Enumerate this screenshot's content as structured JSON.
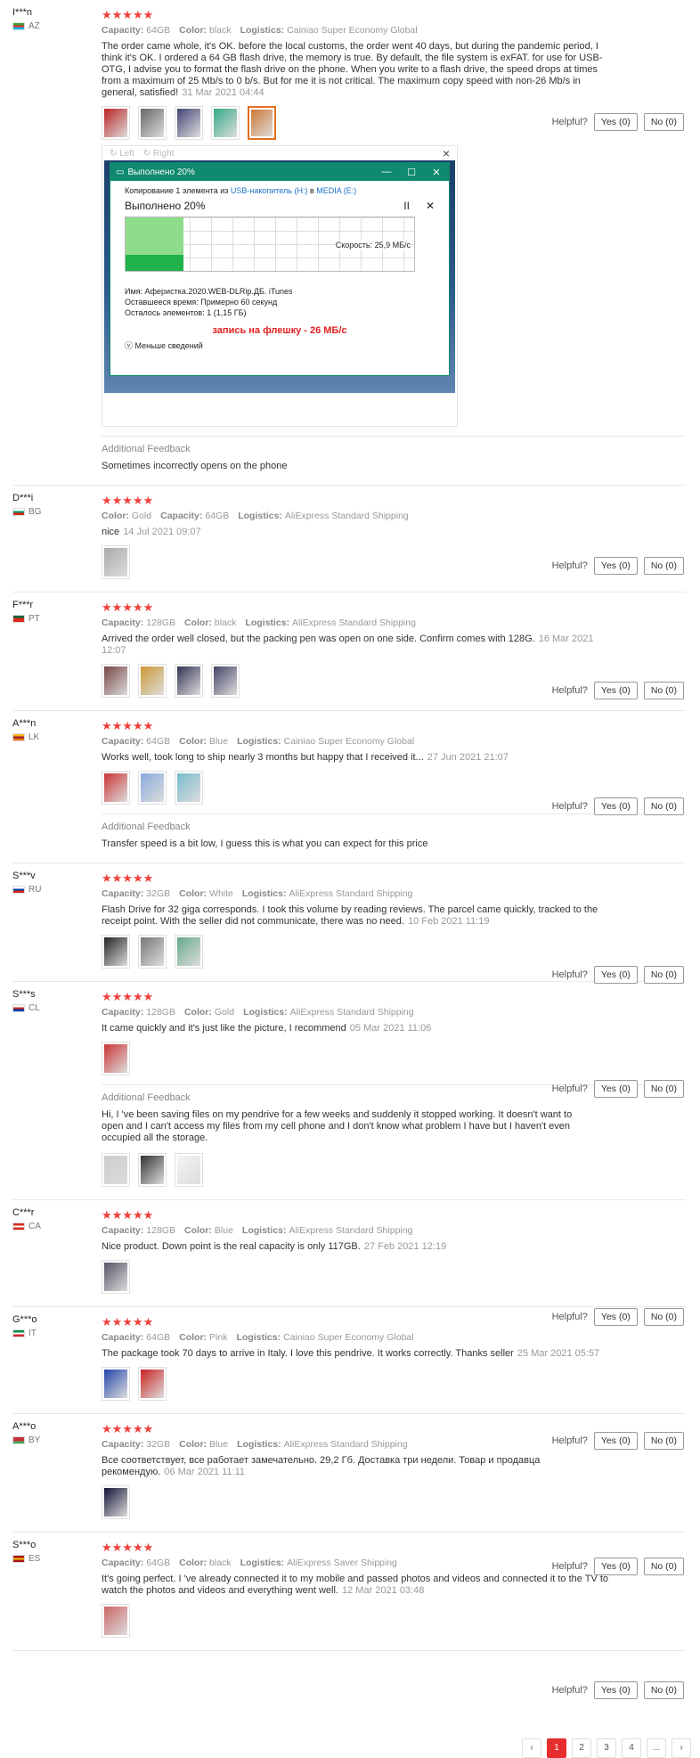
{
  "labels": {
    "capacity": "Capacity:",
    "color": "Color:",
    "logistics": "Logistics:",
    "helpful": "Helpful?",
    "yes": "Yes (0)",
    "no": "No (0)",
    "additional_feedback": "Additional Feedback",
    "stars": "★★★★★"
  },
  "viewer": {
    "left": "Left",
    "right": "Right",
    "close": "×",
    "dialog_title": "Выполнено 20%",
    "copy_line_prefix": "Копирование 1 элемента из",
    "copy_src": "USB-накопитель (H:)",
    "copy_in": "в",
    "copy_dst": "MEDIA (E:)",
    "progress_title": "Выполнено 20%",
    "progress": 0.2,
    "speed_text": "Скорость: 25,9 МБ/с",
    "name_line": "Имя:  Аферистка.2020.WEB-DLRip.ДБ. iTunes",
    "time_line": "Оставшееся время:  Примерно 60 секунд",
    "items_line": "Осталось элементов:  1 (1,15 ГБ)",
    "red_note": "запись на флешку - 26 МБ/с",
    "less_details": "Меньше сведений"
  },
  "reviews": [
    {
      "user": "I***n",
      "country": "AZ",
      "flag_colors": [
        "#3f9c35",
        "#ed2939",
        "#00b9e4"
      ],
      "meta": [
        [
          "Capacity:",
          "64GB"
        ],
        [
          "Color:",
          "black"
        ],
        [
          "Logistics:",
          "Cainiao Super Economy Global"
        ]
      ],
      "text": "The order came whole, it's OK. before the local customs, the order went 40 days, but during the pandemic period, I think it's OK. I ordered a 64 GB flash drive, the memory is true. By default, the file system is exFAT. for use for USB-OTG, I advise you to format the flash drive on the phone. When you write to a flash drive, the speed drops at times from a maximum of 25 Mb/s to 0 b/s. But for me it is not critical. The maximum copy speed with non-26 Mb/s in general, satisfied!",
      "date": "31 Mar 2021 04:44",
      "thumbs": [
        "#b22",
        "#666",
        "#447",
        "#3a8",
        "#c73"
      ],
      "additional": "Sometimes incorrectly opens on the phone"
    },
    {
      "user": "D***i",
      "country": "BG",
      "flag_colors": [
        "#ffffff",
        "#00966e",
        "#d62612"
      ],
      "meta": [
        [
          "Color:",
          "Gold"
        ],
        [
          "Capacity:",
          "64GB"
        ],
        [
          "Logistics:",
          "AliExpress Standard Shipping"
        ]
      ],
      "text": "nice",
      "date": "14 Jul 2021 09:07",
      "thumbs": [
        "#aaa"
      ]
    },
    {
      "user": "F***r",
      "country": "PT",
      "flag_colors": [
        "#046a38",
        "#da291c",
        "#da291c"
      ],
      "meta": [
        [
          "Capacity:",
          "128GB"
        ],
        [
          "Color:",
          "black"
        ],
        [
          "Logistics:",
          "AliExpress Standard Shipping"
        ]
      ],
      "text": "Arrived the order well closed, but the packing pen was open on one side. Confirm comes with 128G.",
      "date": "16 Mar 2021 12:07",
      "thumbs": [
        "#744",
        "#c93",
        "#335",
        "#446"
      ]
    },
    {
      "user": "A***n",
      "country": "LK",
      "flag_colors": [
        "#f7b718",
        "#8d153a",
        "#eb7400"
      ],
      "meta": [
        [
          "Capacity:",
          "64GB"
        ],
        [
          "Color:",
          "Blue"
        ],
        [
          "Logistics:",
          "Cainiao Super Economy Global"
        ]
      ],
      "text": "Works well, took long to ship nearly 3 months but happy that I received it...",
      "date": "27 Jun 2021 21:07",
      "thumbs": [
        "#c33",
        "#8ad",
        "#7bc"
      ],
      "additional": "Transfer speed is a bit low, I guess this is what you can expect for this price"
    },
    {
      "user": "S***v",
      "country": "RU",
      "flag_colors": [
        "#ffffff",
        "#0039a6",
        "#d52b1e"
      ],
      "meta": [
        [
          "Capacity:",
          "32GB"
        ],
        [
          "Color:",
          "White"
        ],
        [
          "Logistics:",
          "AliExpress Standard Shipping"
        ]
      ],
      "text": "Flash Drive for 32 giga corresponds. I took this volume by reading reviews. The parcel came quickly, tracked to the receipt point. With the seller did not communicate, there was no need.",
      "date": "10 Feb 2021 11:19",
      "thumbs": [
        "#222",
        "#777",
        "#6a8"
      ]
    },
    {
      "user": "S***s",
      "country": "CL",
      "flag_colors": [
        "#ffffff",
        "#d52b1e",
        "#0039a6"
      ],
      "meta": [
        [
          "Capacity:",
          "128GB"
        ],
        [
          "Color:",
          "Gold"
        ],
        [
          "Logistics:",
          "AliExpress Standard Shipping"
        ]
      ],
      "text": "It came quickly and it's just like the picture, I recommend",
      "date": "05 Mar 2021 11:06",
      "thumbs": [
        "#c33"
      ],
      "additional": "Hi, I 've been saving files on my pendrive for a few weeks and suddenly it stopped working. It doesn't want to open and I can't access my files from my cell phone and I don't know what problem I have but I haven't even occupied all the storage.",
      "additional_thumbs": [
        "#ccc",
        "#333",
        "#f4f4f4"
      ]
    },
    {
      "user": "C***r",
      "country": "CA",
      "flag_colors": [
        "#d52b1e",
        "#ffffff",
        "#d52b1e"
      ],
      "meta": [
        [
          "Capacity:",
          "128GB"
        ],
        [
          "Color:",
          "Blue"
        ],
        [
          "Logistics:",
          "AliExpress Standard Shipping"
        ]
      ],
      "text": "Nice product. Down point is the real capacity is only 117GB.",
      "date": "27 Feb 2021 12:19",
      "thumbs": [
        "#556"
      ]
    },
    {
      "user": "G***o",
      "country": "IT",
      "flag_colors": [
        "#009246",
        "#ffffff",
        "#ce2b37"
      ],
      "meta": [
        [
          "Capacity:",
          "64GB"
        ],
        [
          "Color:",
          "Pink"
        ],
        [
          "Logistics:",
          "Cainiao Super Economy Global"
        ]
      ],
      "text": "The package took 70 days to arrive in Italy. I love this pendrive. It works correctly. Thanks seller",
      "date": "25 Mar 2021 05:57",
      "thumbs": [
        "#24a",
        "#c22"
      ]
    },
    {
      "user": "A***o",
      "country": "BY",
      "flag_colors": [
        "#c8313e",
        "#c8313e",
        "#4aa657"
      ],
      "meta": [
        [
          "Capacity:",
          "32GB"
        ],
        [
          "Color:",
          "Blue"
        ],
        [
          "Logistics:",
          "AliExpress Standard Shipping"
        ]
      ],
      "text": "Все соответствует, все работает замечательно. 29,2 Гб. Доставка три недели. Товар и продавца рекомендую.",
      "date": "06 Mar 2021 11:11",
      "thumbs": [
        "#113"
      ]
    },
    {
      "user": "S***o",
      "country": "ES",
      "flag_colors": [
        "#aa151b",
        "#f1bf00",
        "#aa151b"
      ],
      "meta": [
        [
          "Capacity:",
          "64GB"
        ],
        [
          "Color:",
          "black"
        ],
        [
          "Logistics:",
          "AliExpress Saver Shipping"
        ]
      ],
      "text": "It's going perfect. I 've already connected it to my mobile and passed photos and videos and connected it to the TV to watch the photos and videos and everything went well.",
      "date": "12 Mar 2021 03:48",
      "thumbs": [
        "#c66"
      ]
    }
  ],
  "pagination": [
    "‹",
    "1",
    "2",
    "3",
    "4",
    "...",
    "›"
  ],
  "pagination_current": "1"
}
